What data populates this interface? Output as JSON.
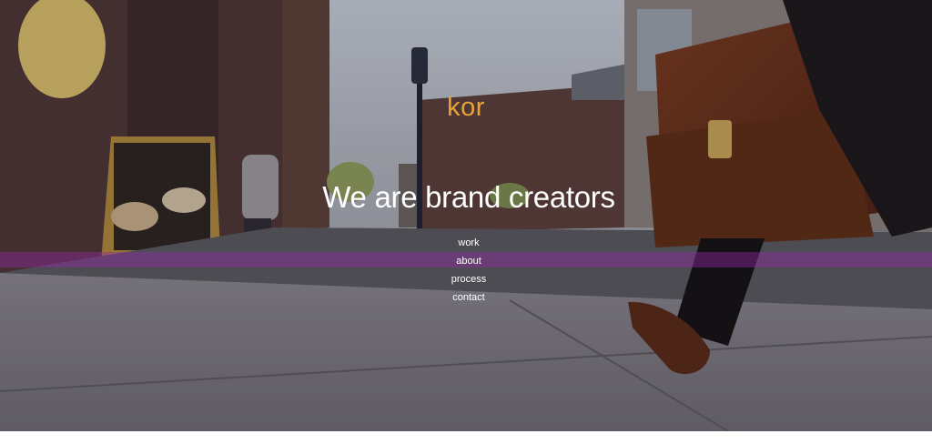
{
  "header": {
    "logo": "kor",
    "tagline": "We are brand creators"
  },
  "nav": {
    "items": [
      {
        "label": "work"
      },
      {
        "label": "about"
      },
      {
        "label": "process"
      },
      {
        "label": "contact"
      }
    ]
  },
  "colors": {
    "logo": "#e8a33a",
    "nav_band": "#9628aa",
    "text": "#ffffff"
  }
}
